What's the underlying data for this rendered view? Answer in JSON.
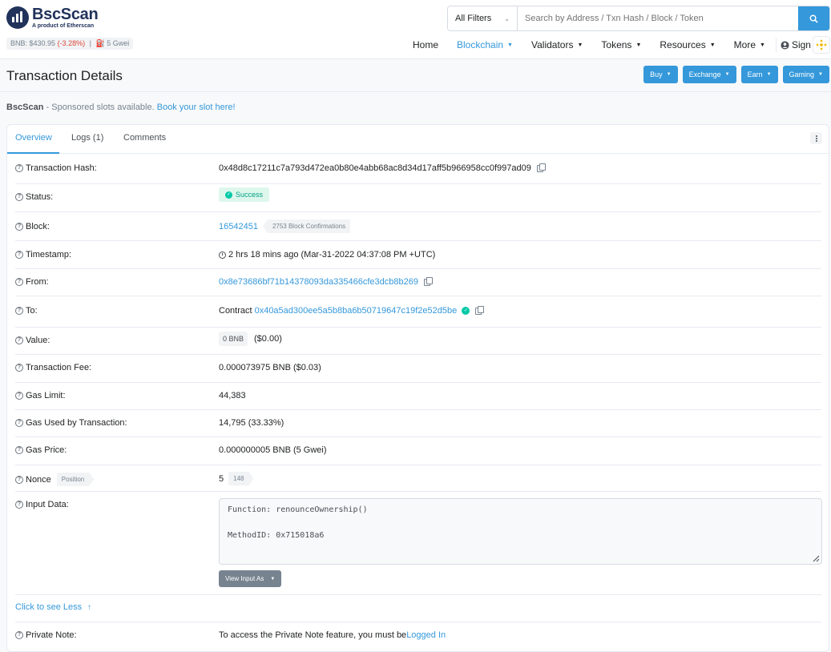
{
  "brand": {
    "name": "BscScan",
    "tagline": "A product of Etherscan"
  },
  "price_bar": {
    "price": "BNB: $430.95",
    "change": "(-3.28%)",
    "sep": "|",
    "gas": "5 Gwei"
  },
  "search": {
    "filter": "All Filters",
    "placeholder": "Search by Address / Txn Hash / Block / Token"
  },
  "nav": {
    "home": "Home",
    "blockchain": "Blockchain",
    "validators": "Validators",
    "tokens": "Tokens",
    "resources": "Resources",
    "more": "More",
    "signin": "Sign In"
  },
  "page_title": "Transaction Details",
  "header_buttons": {
    "buy": "Buy",
    "exchange": "Exchange",
    "earn": "Earn",
    "gaming": "Gaming"
  },
  "sponsor": {
    "brand": "BscScan",
    "text": " - Sponsored slots available. ",
    "link": "Book your slot here!"
  },
  "tabs": {
    "overview": "Overview",
    "logs": "Logs (1)",
    "comments": "Comments"
  },
  "details": {
    "tx_hash": {
      "label": "Transaction Hash:",
      "value": "0x48d8c17211c7a793d472ea0b80e4abb68ac8d34d17aff5b966958cc0f997ad09"
    },
    "status": {
      "label": "Status:",
      "value": "Success"
    },
    "block": {
      "label": "Block:",
      "value": "16542451",
      "confirmations": "2753 Block Confirmations"
    },
    "timestamp": {
      "label": "Timestamp:",
      "value": "2 hrs 18 mins ago (Mar-31-2022 04:37:08 PM +UTC)"
    },
    "from": {
      "label": "From:",
      "value": "0x8e73686bf71b14378093da335466cfe3dcb8b269"
    },
    "to": {
      "label": "To:",
      "prefix": "Contract",
      "value": "0x40a5ad300ee5a5b8ba6b50719647c19f2e52d5be"
    },
    "value": {
      "label": "Value:",
      "amount": "0 BNB",
      "usd": "($0.00)"
    },
    "fee": {
      "label": "Transaction Fee:",
      "value": "0.000073975 BNB ($0.03)"
    },
    "gas_limit": {
      "label": "Gas Limit:",
      "value": "44,383"
    },
    "gas_used": {
      "label": "Gas Used by Transaction:",
      "value": "14,795 (33.33%)"
    },
    "gas_price": {
      "label": "Gas Price:",
      "value": "0.000000005 BNB (5 Gwei)"
    },
    "nonce": {
      "label": "Nonce",
      "position_tag": "Position",
      "value": "5",
      "position": "148"
    },
    "input": {
      "label": "Input Data:",
      "function": "Function: renounceOwnership()",
      "method": "MethodID: 0x715018a6",
      "view_as": "View Input As"
    },
    "see_less": "Click to see Less",
    "private_note": {
      "label": "Private Note:",
      "text": "To access the Private Note feature, you must be ",
      "link": "Logged In"
    }
  },
  "colors": {
    "accent": "#3498db",
    "success": "#00c9a7",
    "negative": "#de4437",
    "text": "#1e2022",
    "muted": "#77838f"
  }
}
